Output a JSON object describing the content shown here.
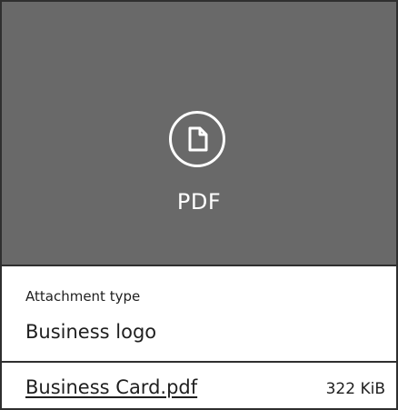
{
  "attachment": {
    "preview": {
      "icon": "document-icon",
      "type_label": "PDF"
    },
    "details": {
      "attachment_type_label": "Attachment type",
      "attachment_type_value": "Business logo"
    },
    "file": {
      "name": "Business Card.pdf",
      "size": "322 KiB"
    }
  },
  "colors": {
    "preview_background": "#696969",
    "border": "#2f2f2f",
    "text": "#1f1f1f",
    "preview_text": "#ffffff"
  }
}
